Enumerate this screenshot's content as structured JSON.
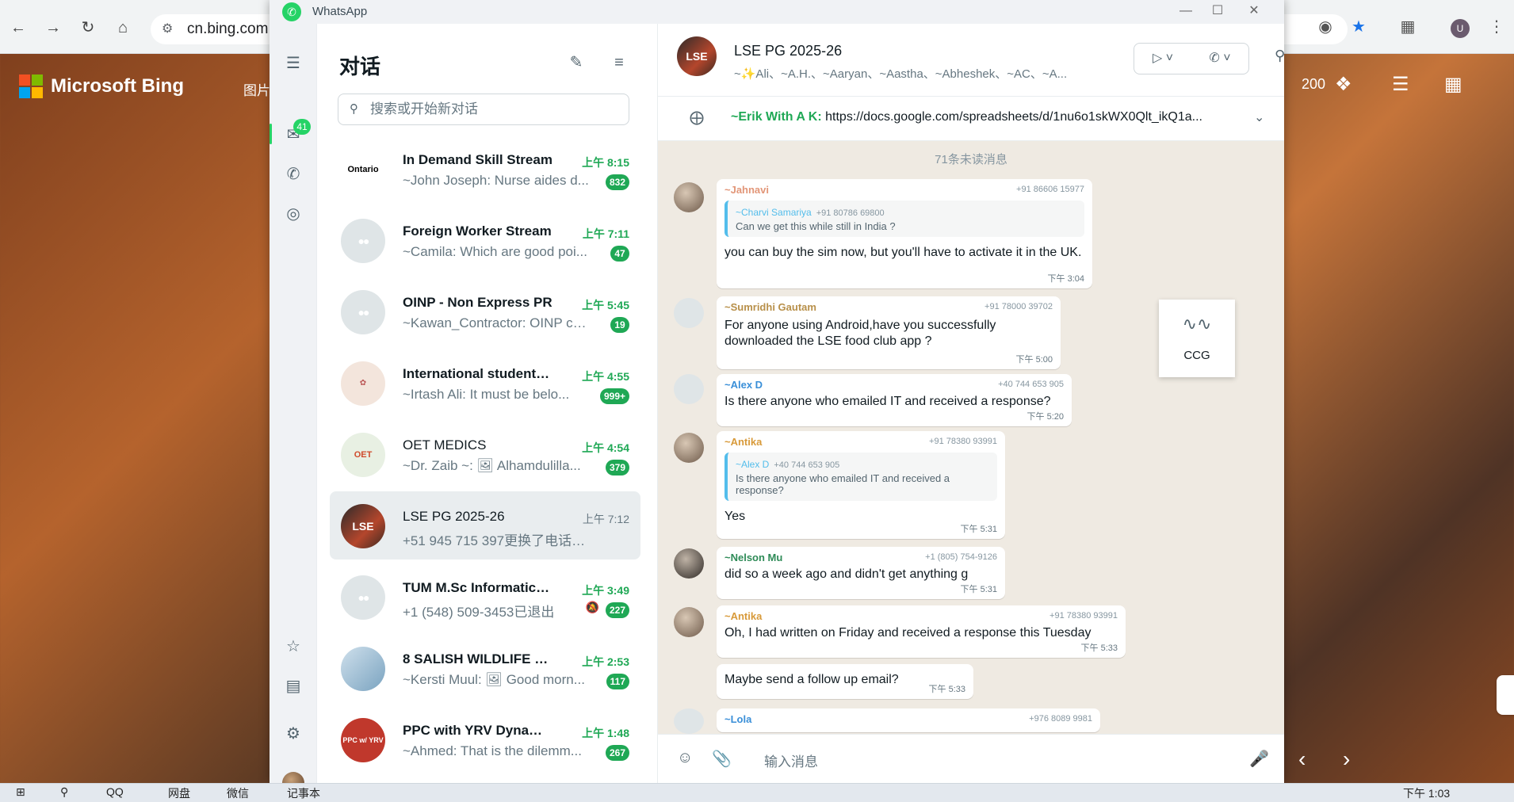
{
  "browser": {
    "url": "cn.bing.com"
  },
  "bing": {
    "logo": "Microsoft Bing",
    "tab_images": "图片",
    "points": "200"
  },
  "window": {
    "title": "WhatsApp"
  },
  "rail": {
    "chats_badge": "41"
  },
  "chatlist": {
    "title": "对话",
    "search_placeholder": "搜索或开始新对话",
    "chats": [
      {
        "name": "In Demand Skill Stream",
        "time": "上午 8:15",
        "preview": "~John Joseph: Nurse aides d...",
        "badge": "832",
        "avatar": "Ontario"
      },
      {
        "name": "Foreign Worker Stream",
        "time": "上午 7:11",
        "preview": "~Camila: Which are good poi...",
        "badge": "47"
      },
      {
        "name": "OINP - Non Express PR",
        "time": "上午 5:45",
        "preview": "~Kawan_Contractor: OINP co...",
        "badge": "19"
      },
      {
        "name": "International students...",
        "time": "上午 4:55",
        "preview": "~Irtash Ali: It must be belo...",
        "badge": "999+"
      },
      {
        "name": "OET MEDICS",
        "time": "上午 4:54",
        "preview": "~Dr. Zaib ~: 🖼 Alhamdulilla...",
        "badge": "379",
        "avatar": "OET MEDICS"
      },
      {
        "name": "LSE PG 2025-26",
        "time": "上午 7:12",
        "preview": "+51 945 715 397更换了电话号...",
        "badge": "",
        "avatar": "LSE"
      },
      {
        "name": "TUM M.Sc Informatics...",
        "time": "上午 3:49",
        "preview": "+1 (548) 509-3453已退出",
        "badge": "227"
      },
      {
        "name": "8 SALISH WILDLIFE W...",
        "time": "上午 2:53",
        "preview": "~Kersti Muul: 🖼 Good morn...",
        "badge": "117"
      },
      {
        "name": "PPC with YRV Dynamics",
        "time": "上午 1:48",
        "preview": "~Ahmed: That is the dilemm...",
        "badge": "267",
        "avatar": "PPC w/ YRV DYNAMICS"
      }
    ]
  },
  "conversation": {
    "name": "LSE PG 2025-26",
    "members": "~✨Ali、~A.H.、~Aaryan、~Aastha、~Abheshek、~AC、~A...",
    "pinned": {
      "sender": "~Erik With A K:",
      "text": "https://docs.google.com/spreadsheets/d/1nu6o1skWX0Qlt_ikQ1a..."
    },
    "unread_label": "71条未读消息",
    "messages": [
      {
        "sender": "~Jahnavi",
        "phone": "+91 86606 15977",
        "quote_sender": "~Charvi Samariya",
        "quote_phone": "+91 80786 69800",
        "quote_text": "Can we get this while still in India ?",
        "text": "you can buy the sim now, but you'll have to activate it in the UK.",
        "time": "下午 3:04"
      },
      {
        "sender": "~Sumridhi Gautam",
        "phone": "+91 78000 39702",
        "text": "For anyone using Android,have you successfully downloaded the LSE food club app ?",
        "time": "下午 5:00"
      },
      {
        "sender": "~Alex D",
        "phone": "+40 744 653 905",
        "text": "Is there anyone who emailed IT and received a response?",
        "time": "下午 5:20"
      },
      {
        "sender": "~Antika",
        "phone": "+91 78380 93991",
        "quote_sender": "~Alex D",
        "quote_phone": "+40 744 653 905",
        "quote_text": "Is there anyone who emailed IT and received a response?",
        "text": "Yes",
        "time": "下午 5:31"
      },
      {
        "sender": "~Nelson Mu",
        "phone": "+1 (805) 754-9126",
        "text": "did so a week ago and didn't get anything g",
        "time": "下午 5:31"
      },
      {
        "sender": "~Antika",
        "phone": "+91 78380 93991",
        "text": "Oh, I had written on Friday and received a response this Tuesday",
        "time": "下午 5:33"
      },
      {
        "text": "Maybe send a follow up email?",
        "time": "下午 5:33"
      },
      {
        "sender": "~Lola",
        "phone": "+976 8089 9981"
      }
    ],
    "composer_placeholder": "输入消息"
  },
  "floating": {
    "ccg_label": "CCG"
  },
  "taskbar": {
    "time": "下午 1:03",
    "items": [
      "QQ",
      "网盘",
      "微信",
      "记事本"
    ]
  },
  "colors": {
    "accent": "#25d366",
    "unread_green": "#1fa855",
    "chat_bg": "#efeae2"
  }
}
